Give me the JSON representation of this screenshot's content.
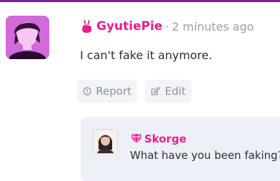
{
  "colors": {
    "accent_border": "#7b1fa2",
    "author_name": "#e91e8c",
    "meta_text": "#9aa0ab",
    "button_bg": "#f2f4f8",
    "reply_bg": "#eef0f7"
  },
  "comment": {
    "avatar_icon": "user-avatar",
    "role_icon": "peace-hand-icon",
    "author": "GyutiePie",
    "separator": "·",
    "time_ago": "2 minutes ago",
    "text": "I can't fake it anymore.",
    "actions": {
      "report_icon": "exclamation-circle-icon",
      "report_label": "Report",
      "edit_icon": "pencil-square-icon",
      "edit_label": "Edit"
    }
  },
  "reply": {
    "avatar_icon": "user-avatar",
    "role_icon": "gem-icon",
    "author": "Skorge",
    "text": "What have you been faking?"
  }
}
